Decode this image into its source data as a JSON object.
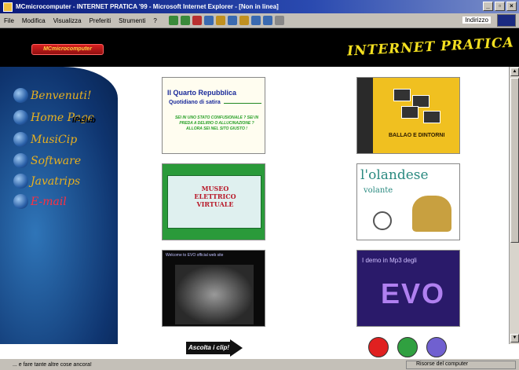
{
  "window": {
    "title": "MCmicrocomputer - INTERNET PRATICA '99 - Microsoft Internet Explorer - [Non in linea]"
  },
  "menubar": {
    "items": [
      "File",
      "Modifica",
      "Visualizza",
      "Preferiti",
      "Strumenti",
      "?"
    ],
    "address_label": "Indirizzo"
  },
  "header": {
    "logo_text": "MCmicrocomputer",
    "site_title": "INTERNET PRATICA"
  },
  "sidebar": {
    "items": [
      {
        "label": "Benvenuti!"
      },
      {
        "label": "Home Page"
      },
      {
        "label": "MusiCip"
      },
      {
        "label": "Software"
      },
      {
        "label": "Javatrips"
      },
      {
        "label": "E-mail",
        "color": "#ff3040"
      }
    ],
    "ipclub": "IPclub"
  },
  "banners": {
    "quarto": {
      "title": "Il Quarto Repubblica",
      "subtitle": "Quotidiano di satira",
      "tagline": "SEI IN UNO STATO CONFUSIONALE ? SEI IN PREDA A DELIRIO O ALLUCINAZIONE ? ALLORA SEI NEL SITO GIUSTO !"
    },
    "ballao": {
      "title": "BALLAO E DINTORNI"
    },
    "museo": {
      "title": "MUSEO ELETTRICO VIRTUALE"
    },
    "olandese": {
      "title_line1": "l'olandese",
      "title_line2": "volante"
    },
    "evo_site": {
      "caption": "Welcome to EVO official web site"
    },
    "evo_demo": {
      "caption": "I demo in Mp3 degli",
      "title": "EVO"
    }
  },
  "controls": {
    "listen_button": "Ascolta i clip!",
    "color_buttons": [
      "#e02020",
      "#30a040",
      "#7060d0"
    ]
  },
  "statusbar": {
    "text": "... e fare tante altre cose ancora!",
    "zone": "Risorse del computer"
  }
}
